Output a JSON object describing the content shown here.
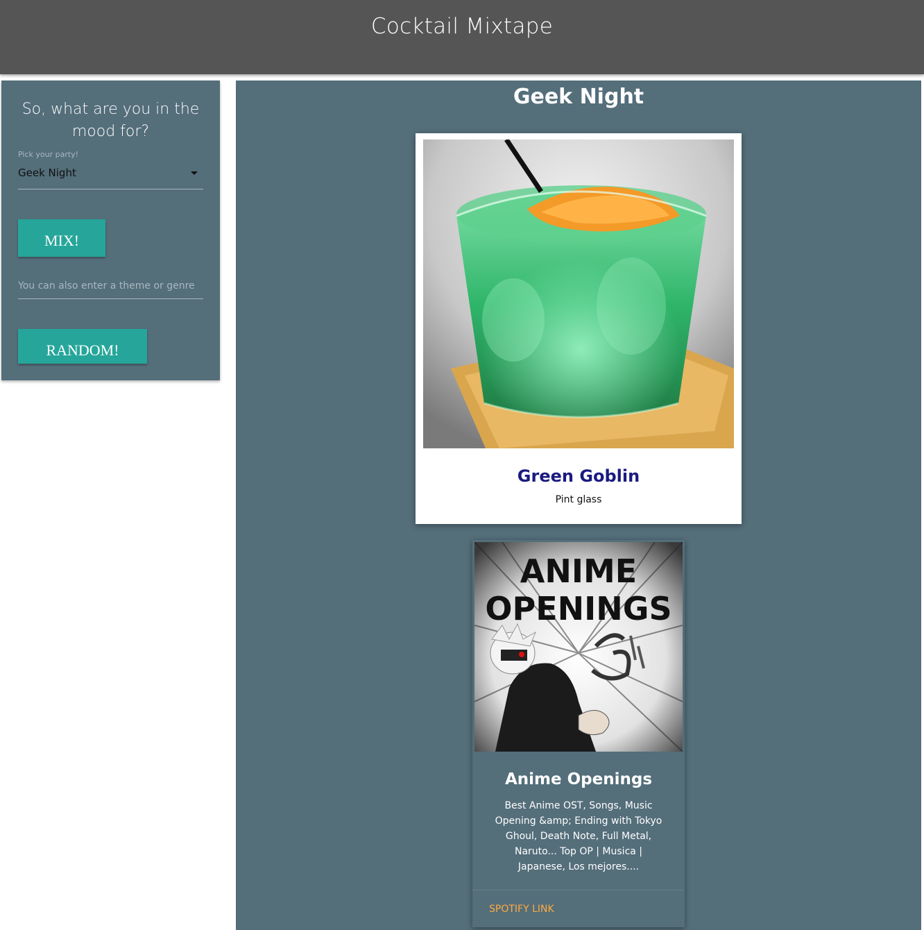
{
  "header": {
    "title": "Cocktail Mixtape"
  },
  "sidebar": {
    "prompt": "So, what are you in the mood for?",
    "select_label": "Pick your party!",
    "select_value": "Geek Night",
    "mix_label": "MIX!",
    "theme_placeholder": "You can also enter a theme or genre",
    "random_label": "RANDOM!"
  },
  "main": {
    "party_title": "Geek Night",
    "drink": {
      "name": "Green Goblin",
      "glass": "Pint glass"
    },
    "playlist": {
      "image_text_line1": "ANIME",
      "image_text_line2": "OPENINGS",
      "name": "Anime Openings",
      "description": "Best Anime OST, Songs, Music Opening &amp; Ending with Tokyo Ghoul, Death Note, Full Metal, Naruto... Top OP | Musica | Japanese, Los mejores....",
      "link_label": "SPOTIFY LINK"
    }
  },
  "colors": {
    "header_bg": "#555555",
    "panel_bg": "#546e7a",
    "button_teal": "#26a69a",
    "drink_name": "#1a1a80",
    "link_orange": "#ffab40"
  }
}
